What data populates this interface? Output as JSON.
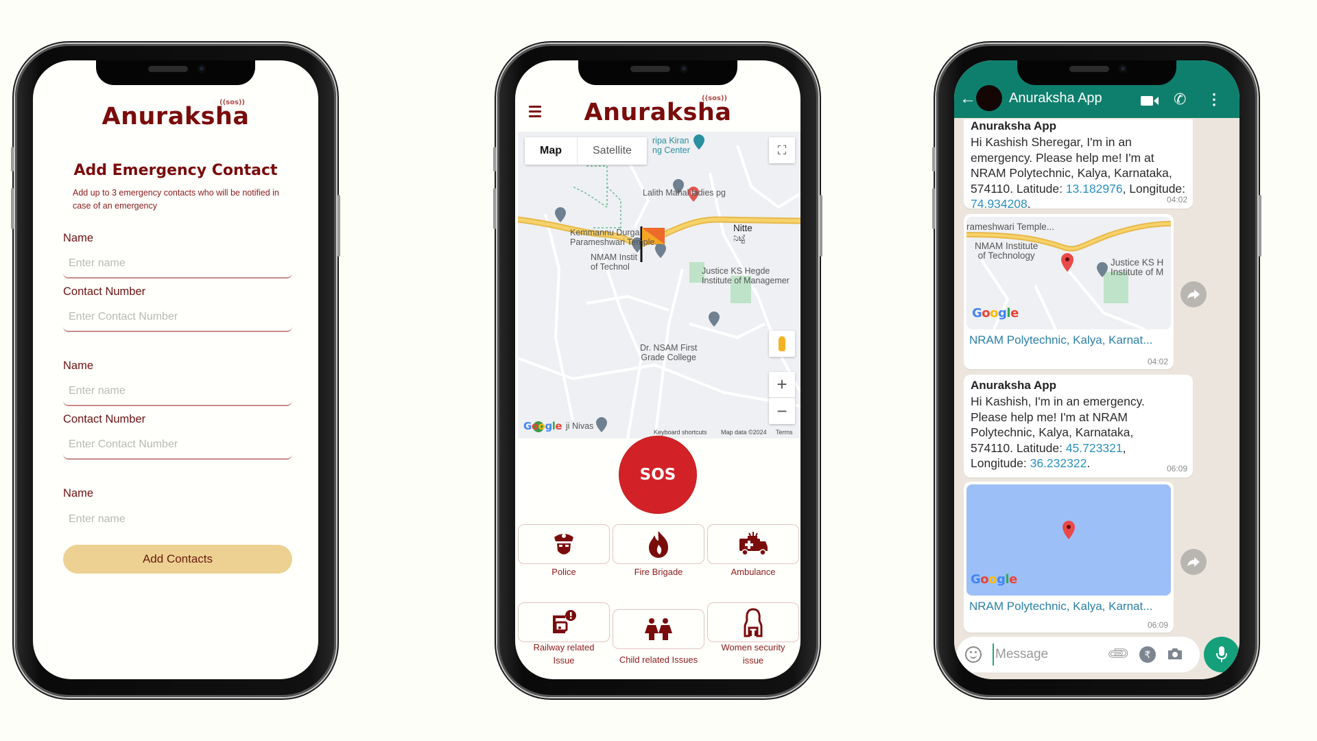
{
  "brand": {
    "name": "Anuraksha",
    "badge": "((sos))",
    "primary_color": "#7a0c0c",
    "sos_color": "#d32227",
    "button_color": "#ecd193"
  },
  "add_contact_screen": {
    "title": "Add Emergency Contact",
    "subtitle": "Add up to 3 emergency contacts who will be notified in case of an emergency",
    "fields": [
      {
        "label": "Name",
        "placeholder": "Enter name",
        "value": ""
      },
      {
        "label": "Contact Number",
        "placeholder": "Enter Contact Number",
        "value": ""
      },
      {
        "label": "Name",
        "placeholder": "Enter name",
        "value": ""
      },
      {
        "label": "Contact Number",
        "placeholder": "Enter Contact Number",
        "value": ""
      },
      {
        "label": "Name",
        "placeholder": "Enter name",
        "value": ""
      }
    ],
    "submit_label": "Add Contacts"
  },
  "sos_screen": {
    "menu_icon": "hamburger-icon",
    "map": {
      "type_toggle": [
        "Map",
        "Satellite"
      ],
      "selected_type": "Map",
      "labels": {
        "kripa": "ripa Kiran",
        "kripa2": "ng Center",
        "lalith": "Lalith Mahal ladies pg",
        "nitte": "Nitte",
        "nitte_kn": "ನಿಟ್ಟೆ",
        "kemmannu1": "Kemmannu Durga",
        "kemmannu2": "Parameshwari Temple...",
        "nmam1": "NMAM Instit",
        "nmam2": "of Technol",
        "justice1": "Justice KS Hegde",
        "justice2": "Institute of Managemer",
        "nsam1": "Dr. NSAM First",
        "nsam2": "Grade College",
        "nivas": "ji Nivas"
      },
      "footer": {
        "shortcuts": "Keyboard shortcuts",
        "data": "Map data ©2024",
        "terms": "Terms"
      },
      "google": "Google"
    },
    "sos_label": "SOS",
    "services": [
      {
        "label": "Police",
        "icon": "police-icon"
      },
      {
        "label": "Fire Brigade",
        "icon": "fire-icon"
      },
      {
        "label": "Ambulance",
        "icon": "ambulance-icon"
      },
      {
        "label": "Railway related Issue",
        "icon": "railway-alert-icon"
      },
      {
        "label": "Child related Issues",
        "icon": "children-icon"
      },
      {
        "label": "Women security issue",
        "icon": "woman-icon"
      }
    ]
  },
  "whatsapp_screen": {
    "header": {
      "title": "Anuraksha App",
      "icons": [
        "back-arrow-icon",
        "video-call-icon",
        "phone-call-icon",
        "more-options-icon"
      ],
      "color": "#0f7f6d"
    },
    "messages": [
      {
        "sender": "Anuraksha App",
        "text_before_lat": "Hi Kashish Sheregar, I'm in an emergency. Please help me! I'm at NRAM Polytechnic, Kalya, Karnataka, 574110. Latitude: ",
        "latitude": "13.182976",
        "text_between": ", Longitude: ",
        "longitude": "74.934208",
        "text_end": ".",
        "time": "04:02"
      },
      {
        "type": "location",
        "place": "NRAM Polytechnic, Kalya, Karnat...",
        "map_labels": [
          "rameshwari Temple...",
          "NMAM Institute",
          "of Technology",
          "Justice KS H",
          "Institute of M"
        ],
        "time": "04:02"
      },
      {
        "sender": "Anuraksha App",
        "text_before_lat": "Hi Kashish, I'm in an emergency. Please help me! I'm at NRAM Polytechnic, Kalya, Karnataka, 574110. Latitude: ",
        "latitude": "45.723321",
        "text_between": ", Longitude: ",
        "longitude": "36.232322",
        "text_end": ".",
        "time": "06:09"
      },
      {
        "type": "location",
        "place": "NRAM Polytechnic, Kalya, Karnat...",
        "time": "06:09"
      }
    ],
    "input": {
      "placeholder": "Message",
      "value": ""
    },
    "google": "Google"
  }
}
